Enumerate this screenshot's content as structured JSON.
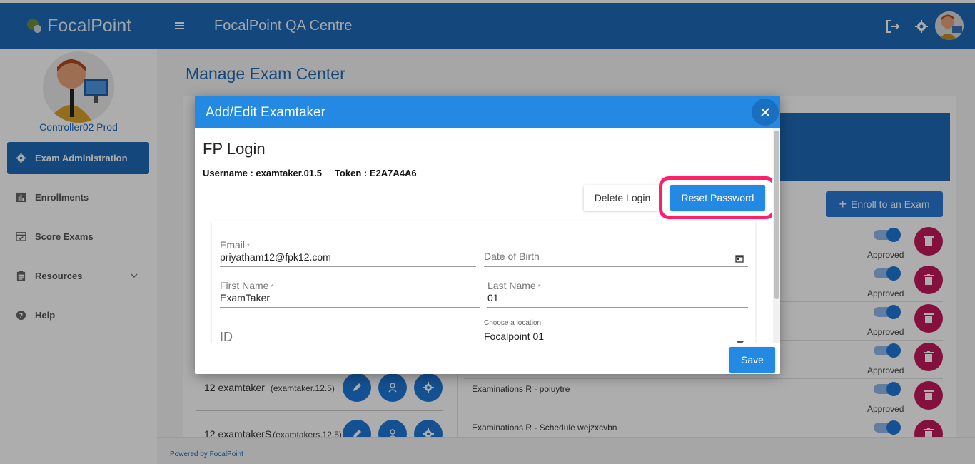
{
  "header": {
    "brand": "FocalPoint",
    "title": "FocalPoint QA Centre"
  },
  "sidebar": {
    "user": "Controller02 Prod",
    "items": [
      {
        "label": "Exam Administration"
      },
      {
        "label": "Enrollments"
      },
      {
        "label": "Score Exams"
      },
      {
        "label": "Resources"
      },
      {
        "label": "Help"
      }
    ]
  },
  "main": {
    "title": "Manage Exam Center",
    "enroll_label": "Enroll to an Exam",
    "approved_label": "Approved",
    "exams": [
      "Examinations R - poiuytre",
      "Examinations R - Schedule wejzxcvbn"
    ],
    "takers": [
      {
        "name": "12 examtaker",
        "username": "(examtaker.12.5)"
      },
      {
        "name": "12 examtakerS",
        "username": "(examtakers.12.5)"
      }
    ]
  },
  "footer": {
    "text": "Powered by FocalPoint"
  },
  "modal": {
    "title": "Add/Edit Examtaker",
    "close_icon": "close-icon",
    "section_title": "FP Login",
    "username_line": "Username : examtaker.01.5",
    "token_line": "Token : E2A7A4A6",
    "delete_login": "Delete Login",
    "reset_password": "Reset Password",
    "fields": {
      "email": {
        "label": "Email",
        "value": "priyatham12@fpk12.com"
      },
      "dob": {
        "label": "Date of Birth",
        "value": ""
      },
      "first_name": {
        "label": "First Name",
        "value": "ExamTaker"
      },
      "last_name": {
        "label": "Last Name",
        "value": "01"
      },
      "id": {
        "label": "ID"
      },
      "location": {
        "label": "Choose a location",
        "value": "Focalpoint 01"
      }
    },
    "required_mark": "*",
    "save": "Save"
  },
  "colors": {
    "primary": "#1e6bb8",
    "modal_header": "#2389e2",
    "delete": "#c2185b",
    "highlight": "#ff1f6a"
  }
}
